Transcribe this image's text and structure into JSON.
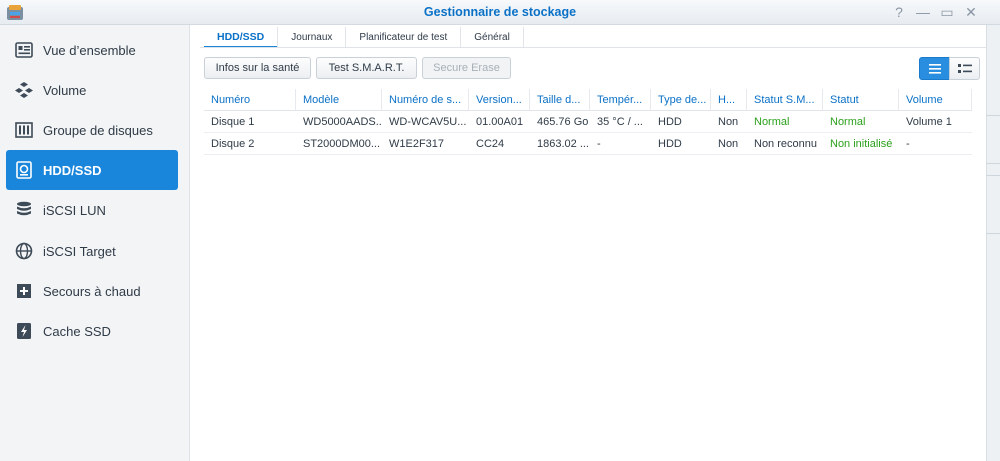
{
  "window": {
    "title": "Gestionnaire de stockage",
    "controls": [
      "?",
      "—",
      "▭",
      "✕"
    ]
  },
  "sidebar": {
    "items": [
      {
        "label": "Vue d’ensemble",
        "icon": "overview-icon",
        "active": false
      },
      {
        "label": "Volume",
        "icon": "volume-icon",
        "active": false
      },
      {
        "label": "Groupe de disques",
        "icon": "disk-group-icon",
        "active": false
      },
      {
        "label": "HDD/SSD",
        "icon": "hdd-icon",
        "active": true
      },
      {
        "label": "iSCSI LUN",
        "icon": "iscsi-lun-icon",
        "active": false
      },
      {
        "label": "iSCSI Target",
        "icon": "iscsi-target-icon",
        "active": false
      },
      {
        "label": "Secours à chaud",
        "icon": "hot-spare-icon",
        "active": false
      },
      {
        "label": "Cache SSD",
        "icon": "ssd-cache-icon",
        "active": false
      }
    ]
  },
  "tabs": [
    {
      "label": "HDD/SSD",
      "active": true
    },
    {
      "label": "Journaux",
      "active": false
    },
    {
      "label": "Planificateur de test",
      "active": false
    },
    {
      "label": "Général",
      "active": false
    }
  ],
  "toolbar": {
    "health_info": "Infos sur la santé",
    "smart_test": "Test S.M.A.R.T.",
    "secure_erase": "Secure Erase"
  },
  "table": {
    "columns": [
      "Numéro",
      "Modèle",
      "Numéro de s...",
      "Version...",
      "Taille d...",
      "Tempér...",
      "Type de...",
      "H...",
      "Statut S.M...",
      "Statut",
      "Volume"
    ],
    "rows": [
      [
        "Disque 1",
        "WD5000AADS...",
        "WD-WCAV5U...",
        "01.00A01",
        "465.76 Go",
        "35 °C / ...",
        "HDD",
        "Non",
        "Normal",
        "Normal",
        "Volume 1"
      ],
      [
        "Disque 2",
        "ST2000DM00...",
        "W1E2F317",
        "CC24",
        "1863.02 ...",
        "-",
        "HDD",
        "Non",
        "Non reconnu",
        "Non initialisé",
        "-"
      ]
    ]
  },
  "colors": {
    "accent": "#1a86db",
    "title": "#0b71c7",
    "ok_green": "#2aa01b"
  }
}
